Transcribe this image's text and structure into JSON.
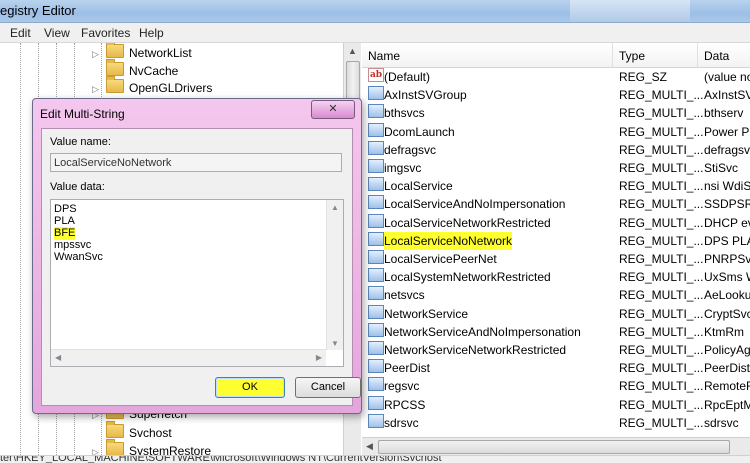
{
  "window": {
    "title": "egistry Editor"
  },
  "menu": [
    "Edit",
    "View",
    "Favorites",
    "Help"
  ],
  "tree": {
    "items_top": [
      "NetworkList",
      "NvCache",
      "OpenGLDrivers"
    ],
    "items_bottom": [
      "Superfetch",
      "Svchost",
      "SystemRestore"
    ]
  },
  "list": {
    "headers": {
      "name": "Name",
      "type": "Type",
      "data": "Data"
    },
    "rows": [
      {
        "name": "(Default)",
        "type": "REG_SZ",
        "data": "(value no",
        "icon": "string-value-icon"
      },
      {
        "name": "AxInstSVGroup",
        "type": "REG_MULTI_...",
        "data": "AxInstSV",
        "icon": "binary-value-icon"
      },
      {
        "name": "bthsvcs",
        "type": "REG_MULTI_...",
        "data": "bthserv",
        "icon": "binary-value-icon"
      },
      {
        "name": "DcomLaunch",
        "type": "REG_MULTI_...",
        "data": "Power Pl",
        "icon": "binary-value-icon"
      },
      {
        "name": "defragsvc",
        "type": "REG_MULTI_...",
        "data": "defragsvc",
        "icon": "binary-value-icon"
      },
      {
        "name": "imgsvc",
        "type": "REG_MULTI_...",
        "data": "StiSvc",
        "icon": "binary-value-icon"
      },
      {
        "name": "LocalService",
        "type": "REG_MULTI_...",
        "data": "nsi WdiSe",
        "icon": "binary-value-icon"
      },
      {
        "name": "LocalServiceAndNoImpersonation",
        "type": "REG_MULTI_...",
        "data": "SSDPSRV",
        "icon": "binary-value-icon"
      },
      {
        "name": "LocalServiceNetworkRestricted",
        "type": "REG_MULTI_...",
        "data": "DHCP eve",
        "icon": "binary-value-icon"
      },
      {
        "name": "LocalServiceNoNetwork",
        "type": "REG_MULTI_...",
        "data": "DPS PLA",
        "icon": "binary-value-icon"
      },
      {
        "name": "LocalServicePeerNet",
        "type": "REG_MULTI_...",
        "data": "PNRPSvc",
        "icon": "binary-value-icon"
      },
      {
        "name": "LocalSystemNetworkRestricted",
        "type": "REG_MULTI_...",
        "data": "UxSms W",
        "icon": "binary-value-icon"
      },
      {
        "name": "netsvcs",
        "type": "REG_MULTI_...",
        "data": "AeLooku",
        "icon": "binary-value-icon"
      },
      {
        "name": "NetworkService",
        "type": "REG_MULTI_...",
        "data": "CryptSvc",
        "icon": "binary-value-icon"
      },
      {
        "name": "NetworkServiceAndNoImpersonation",
        "type": "REG_MULTI_...",
        "data": "KtmRm",
        "icon": "binary-value-icon"
      },
      {
        "name": "NetworkServiceNetworkRestricted",
        "type": "REG_MULTI_...",
        "data": "PolicyAg",
        "icon": "binary-value-icon"
      },
      {
        "name": "PeerDist",
        "type": "REG_MULTI_...",
        "data": "PeerDistS",
        "icon": "binary-value-icon"
      },
      {
        "name": "regsvc",
        "type": "REG_MULTI_...",
        "data": "RemoteR",
        "icon": "binary-value-icon"
      },
      {
        "name": "RPCSS",
        "type": "REG_MULTI_...",
        "data": "RpcEptM",
        "icon": "binary-value-icon"
      },
      {
        "name": "sdrsvc",
        "type": "REG_MULTI_...",
        "data": "sdrsvc",
        "icon": "binary-value-icon"
      }
    ]
  },
  "dialog": {
    "title": "Edit Multi-String",
    "close_label": "✕",
    "value_name_label": "Value name:",
    "value_name": "LocalServiceNoNetwork",
    "value_data_label": "Value data:",
    "value_data": [
      "DPS",
      "PLA",
      "BFE",
      "mpssvc",
      "WwanSvc"
    ],
    "ok_label": "OK",
    "cancel_label": "Cancel"
  },
  "status": {
    "path": "ter\\HKEY_LOCAL_MACHINE\\SOFTWARE\\Microsoft\\Windows NT\\CurrentVersion\\Svchost"
  },
  "colors": {
    "highlight": "#ffff30",
    "dialog_frame": "#e4a6dc"
  }
}
